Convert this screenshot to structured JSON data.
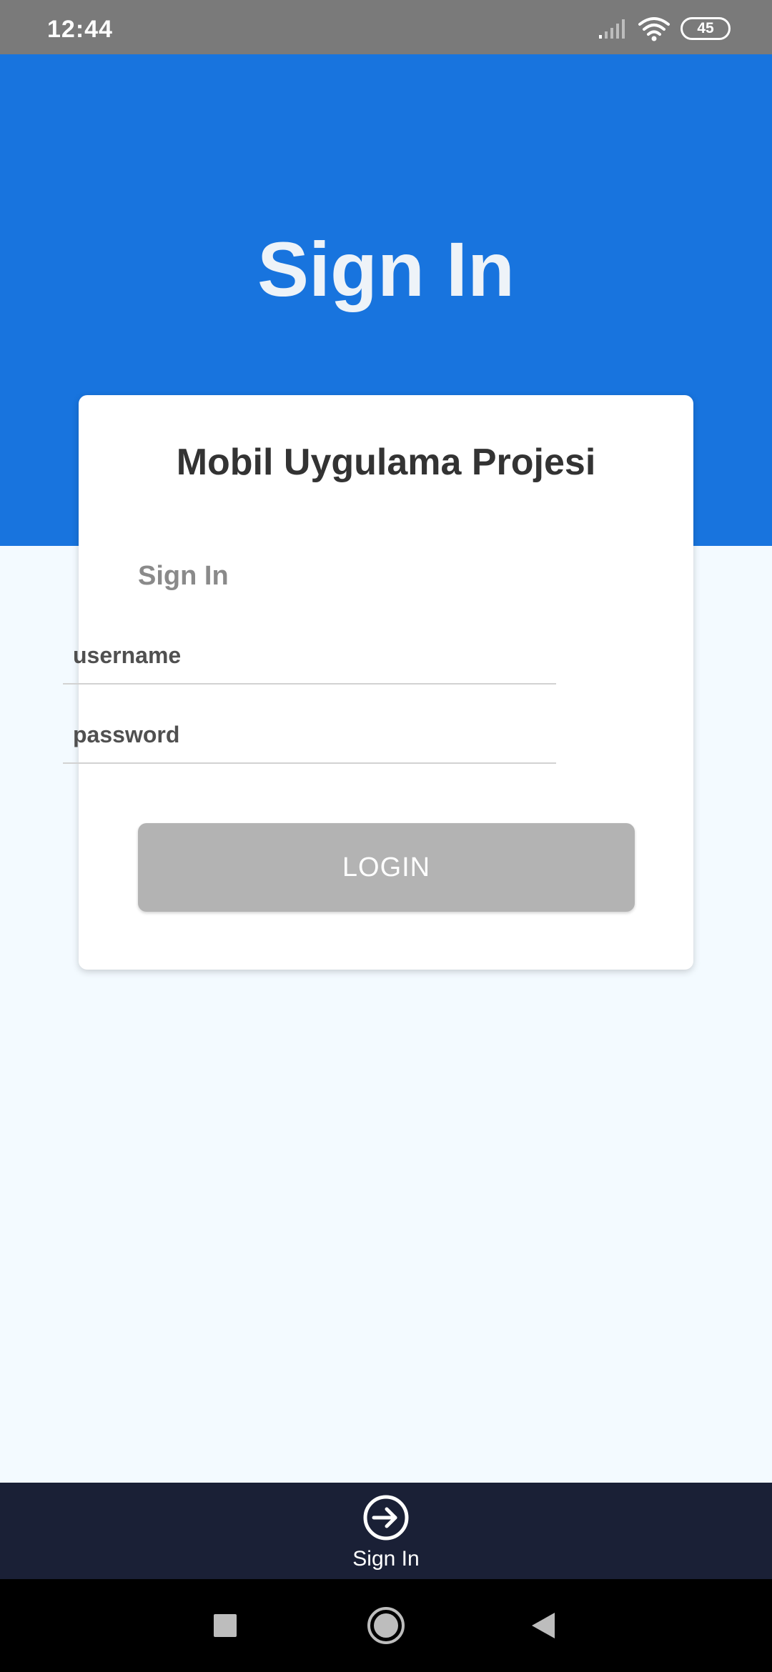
{
  "status_bar": {
    "time": "12:44",
    "battery": "45",
    "icons": [
      "signal-icon",
      "wifi-icon",
      "battery-icon"
    ]
  },
  "hero": {
    "title": "Sign In"
  },
  "card": {
    "title": "Mobil Uygulama Projesi",
    "section_label": "Sign In",
    "username": {
      "placeholder": "username",
      "value": ""
    },
    "password": {
      "placeholder": "password",
      "value": ""
    },
    "login_label": "LOGIN"
  },
  "bottom_nav": {
    "items": [
      {
        "label": "Sign In",
        "icon": "sign-in-icon"
      }
    ]
  },
  "system_nav": {
    "icons": [
      "recent-apps-icon",
      "home-icon",
      "back-icon"
    ]
  },
  "colors": {
    "hero_blue": "#1874DE",
    "background": "#F3FAFF",
    "bottom_nav": "#1A2036",
    "button_disabled": "#B3B3B3"
  }
}
